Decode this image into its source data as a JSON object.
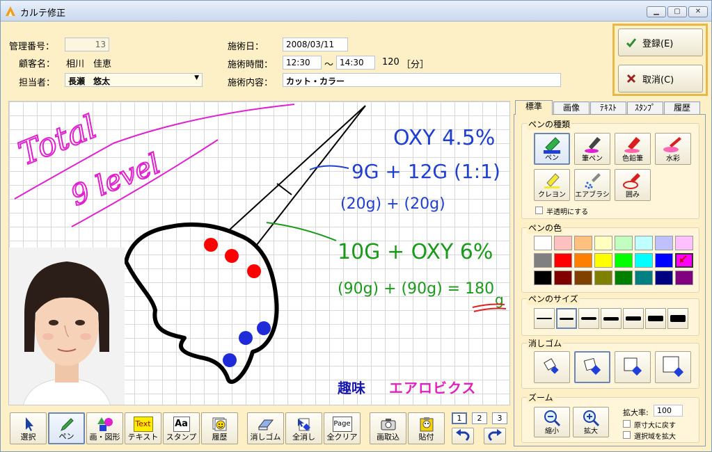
{
  "window": {
    "title": "カルテ修正",
    "minimize_icon": "minimize-icon",
    "maximize_icon": "maximize-icon",
    "close_icon": "close-icon"
  },
  "form": {
    "management_number_label": "管理番号：",
    "management_number_value": "13",
    "customer_label": "顧客名：",
    "customer_value": "相川　佳恵",
    "staff_label": "担当者：",
    "staff_value": "長瀬　悠太",
    "date_label": "施術日：",
    "date_value": "2008/03/11",
    "time_label": "施術時間：",
    "time_start": "12:30",
    "time_sep": "～",
    "time_end": "14:30",
    "duration_value": "120",
    "duration_unit": "［分］",
    "content_label": "施術内容：",
    "content_value": "カット・カラー"
  },
  "actions": {
    "register_label": "登録(E)",
    "cancel_label": "取消(C)"
  },
  "canvas": {
    "handwriting": {
      "total_line1": "Total",
      "total_line2": "9 level",
      "oxy": "OXY 4.5%",
      "mix1": "9G + 12G (1:1)",
      "mix1b": "(20g) + (20g)",
      "mix2": "10G + OXY 6%",
      "mix2b": "(90g) + (90g) = 180",
      "mix2c": "g"
    },
    "hobby_label": "趣味",
    "hobby_value": "エアロビクス"
  },
  "toolbar": {
    "items": [
      {
        "label": "選択",
        "icon": "cursor-icon"
      },
      {
        "label": "ペン",
        "icon": "pen-icon"
      },
      {
        "label": "画・図形",
        "icon": "shapes-icon"
      },
      {
        "label": "テキスト",
        "icon": "text-icon",
        "icon_text": "Text"
      },
      {
        "label": "スタンプ",
        "icon": "stamp-icon",
        "icon_text": "Aa"
      },
      {
        "label": "履歴",
        "icon": "history-icon"
      },
      {
        "label": "消しゴム",
        "icon": "eraser-icon"
      },
      {
        "label": "全消し",
        "icon": "clear-all-icon"
      },
      {
        "label": "全クリア",
        "icon": "page-clear-icon",
        "icon_text": "Page"
      },
      {
        "label": "画取込",
        "icon": "camera-icon"
      },
      {
        "label": "貼付",
        "icon": "paste-icon"
      }
    ],
    "pages": [
      "1",
      "2",
      "3"
    ],
    "undo_icon": "undo-icon",
    "redo_icon": "redo-icon"
  },
  "side": {
    "tabs": [
      "標準",
      "画像",
      "ﾃｷｽﾄ",
      "ｽﾀﾝﾌﾟ",
      "履歴"
    ],
    "pen_type_title": "ペンの種類",
    "pen_types": [
      {
        "label": "ペン",
        "icon": "marker-icon"
      },
      {
        "label": "筆ペン",
        "icon": "brush-pen-icon"
      },
      {
        "label": "色鉛筆",
        "icon": "color-pencil-icon"
      },
      {
        "label": "水彩",
        "icon": "watercolor-icon"
      },
      {
        "label": "クレヨン",
        "icon": "crayon-icon"
      },
      {
        "label": "エアブラシ",
        "icon": "airbrush-icon"
      },
      {
        "label": "囲み",
        "icon": "enclose-icon"
      }
    ],
    "semi_transparent_label": "半透明にする",
    "pen_color_title": "ペンの色",
    "colors": [
      "#ffffff",
      "#ffc0c0",
      "#ffc080",
      "#ffffc0",
      "#c0ffc0",
      "#c0ffff",
      "#c0c0ff",
      "#ffc0ff",
      "#808080",
      "#ff0000",
      "#ff8000",
      "#ffff00",
      "#00ff00",
      "#00ffff",
      "#0000ff",
      "#ff00ff",
      "#000000",
      "#800000",
      "#804000",
      "#808000",
      "#008000",
      "#008080",
      "#000080",
      "#800080"
    ],
    "pen_size_title": "ペンのサイズ",
    "sizes": [
      1,
      2,
      3,
      4,
      5,
      7,
      9
    ],
    "eraser_title": "消しゴム",
    "zoom_title": "ズーム",
    "zoom_out_label": "縮小",
    "zoom_in_label": "拡大",
    "zoom_rate_label": "拡大率:",
    "zoom_rate_value": "100",
    "original_size_label": "原寸大に戻す",
    "expand_selection_label": "選択域を拡大"
  }
}
